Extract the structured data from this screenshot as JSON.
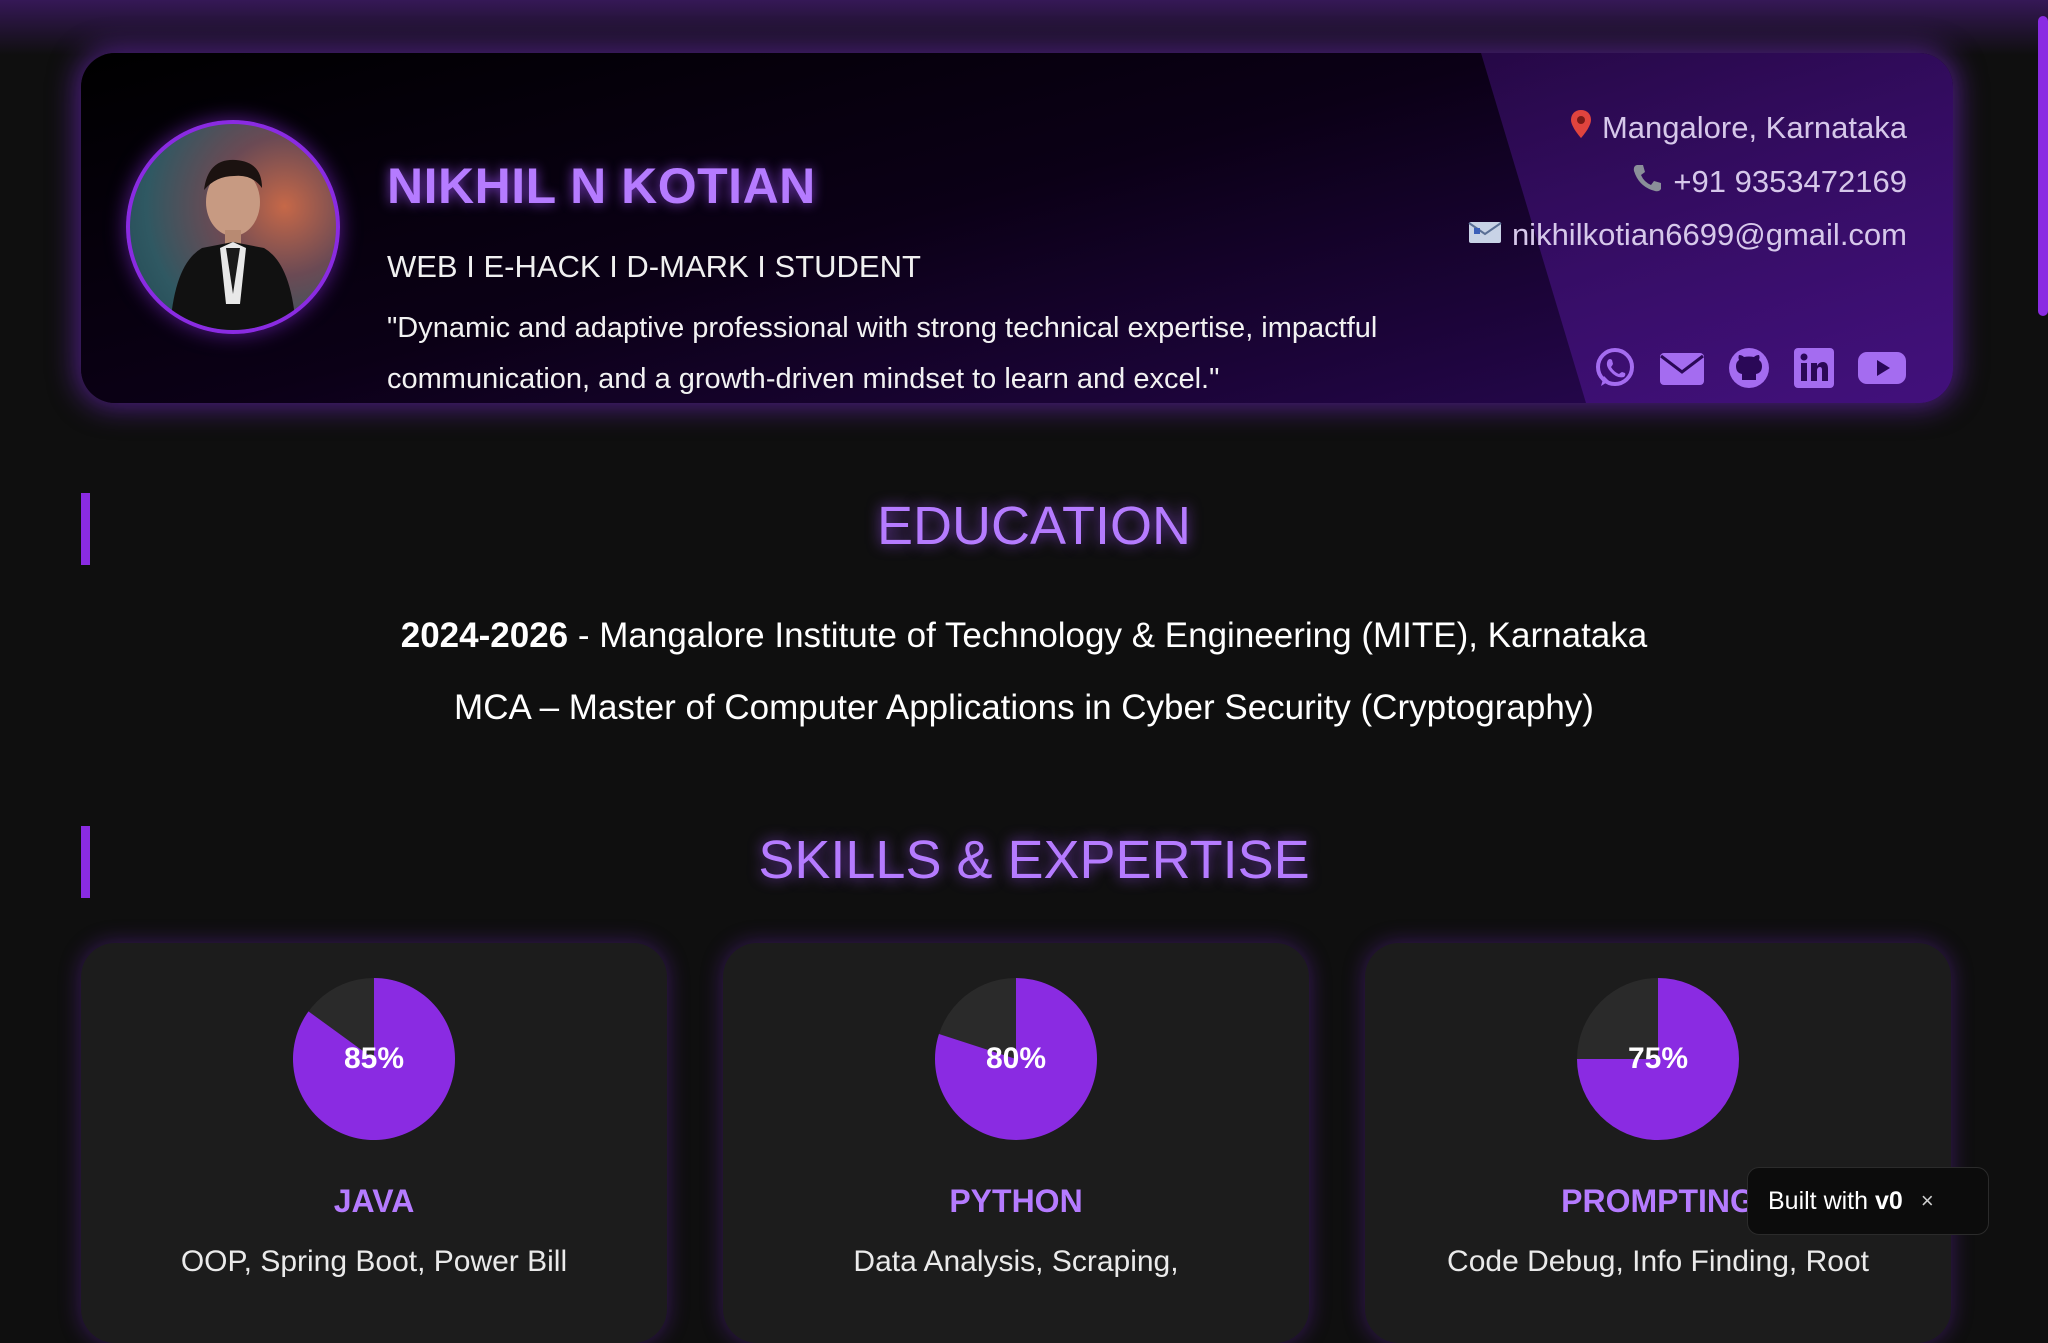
{
  "colors": {
    "accent": "#8a2be2",
    "accent_light": "#b57bff",
    "background": "#0f0f0f",
    "card": "#1c1c1c"
  },
  "header": {
    "name": "NIKHIL N KOTIAN",
    "tagline": "WEB I E-HACK I D-MARK I STUDENT",
    "quote": "\"Dynamic and adaptive professional with strong technical expertise, impactful communication, and a growth-driven mindset to learn and excel.\"",
    "avatar_icon": "person-portrait",
    "contacts": [
      {
        "icon": "pin-icon",
        "text": "Mangalore, Karnataka"
      },
      {
        "icon": "phone-icon",
        "text": "+91 9353472169"
      },
      {
        "icon": "mail-icon",
        "text": "nikhilkotian6699@gmail.com"
      }
    ],
    "socials": [
      "whatsapp-icon",
      "envelope-icon",
      "github-icon",
      "linkedin-icon",
      "youtube-icon"
    ]
  },
  "education": {
    "heading": "EDUCATION",
    "years": "2024-2026",
    "institution": " - Mangalore Institute of Technology & Engineering (MITE), Karnataka",
    "degree": "MCA – Master of Computer Applications in Cyber Security (Cryptography)"
  },
  "skills": {
    "heading": "SKILLS & EXPERTISE",
    "items": [
      {
        "name": "JAVA",
        "percent_label": "85%",
        "percent": 85,
        "desc": "OOP, Spring Boot, Power Bill"
      },
      {
        "name": "PYTHON",
        "percent_label": "80%",
        "percent": 80,
        "desc": "Data Analysis, Scraping,"
      },
      {
        "name": "PROMPTING",
        "percent_label": "75%",
        "percent": 75,
        "desc": "Code Debug, Info Finding, Root"
      }
    ]
  },
  "builtwith": {
    "label": "Built with",
    "logo": "v0",
    "close": "×"
  }
}
